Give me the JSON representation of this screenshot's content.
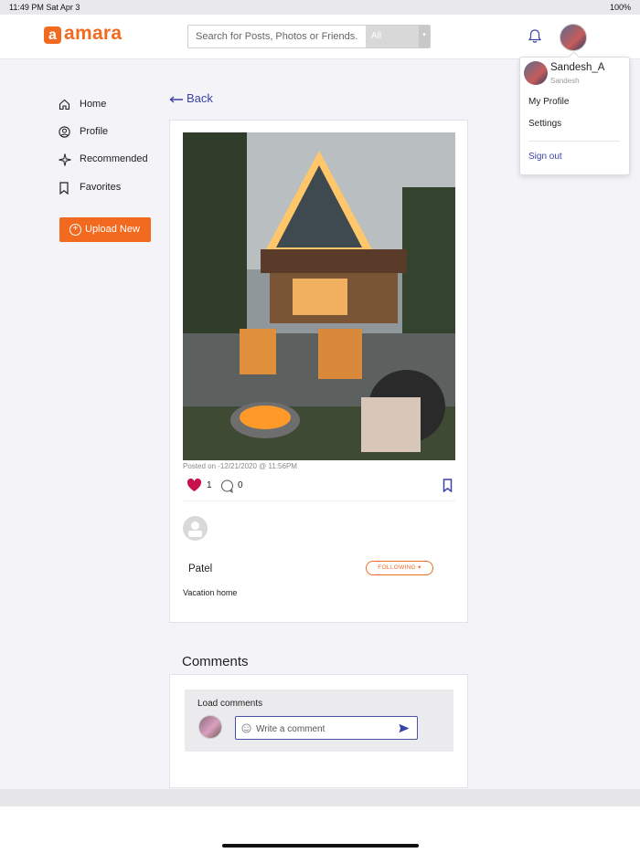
{
  "status_bar": {
    "time_date": "11:49 PM  Sat Apr 3",
    "battery": "100%"
  },
  "header": {
    "logo_mark": "a",
    "logo_text": "amara",
    "search_placeholder": "Search for Posts, Photos or Friends.",
    "search_filter": "All"
  },
  "user_menu": {
    "name": "Sandesh_A",
    "subname": "Sandesh",
    "items": [
      "My Profile",
      "Settings"
    ],
    "sign_out": "Sign out"
  },
  "sidebar": {
    "items": [
      {
        "label": "Home",
        "icon": "home-icon"
      },
      {
        "label": "Profile",
        "icon": "profile-icon"
      },
      {
        "label": "Recommended",
        "icon": "sparkle-icon"
      },
      {
        "label": "Favorites",
        "icon": "bookmark-icon"
      }
    ],
    "upload_label": "Upload New"
  },
  "back_label": "Back",
  "post": {
    "posted": "Posted on -12/21/2020 @ 11:56PM",
    "likes": "1",
    "comments": "0",
    "author": "Patel",
    "follow_label": "FOLLOWING",
    "caption": "Vacation home"
  },
  "comments": {
    "title": "Comments",
    "load_label": "Load comments",
    "placeholder": "Write a comment"
  },
  "colors": {
    "accent": "#f26a20",
    "link": "#3a43a8",
    "heart": "#c8104a"
  }
}
